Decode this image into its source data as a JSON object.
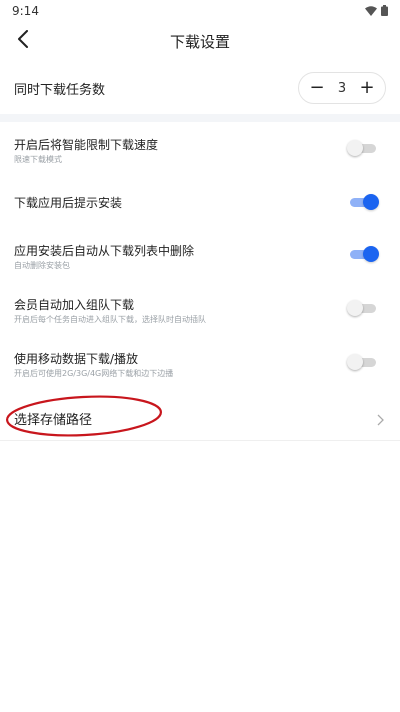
{
  "status_bar": {
    "time": "9:14"
  },
  "header": {
    "title": "下载设置"
  },
  "concurrent": {
    "label": "同时下载任务数",
    "minus": "−",
    "value": "3",
    "plus": "+"
  },
  "settings": [
    {
      "title": "开启后将智能限制下载速度",
      "subtitle": "限速下载模式",
      "enabled": false
    },
    {
      "title": "下载应用后提示安装",
      "subtitle": "",
      "enabled": true
    },
    {
      "title": "应用安装后自动从下载列表中删除",
      "subtitle": "自动删除安装包",
      "enabled": true
    },
    {
      "title": "会员自动加入组队下载",
      "subtitle": "开启后每个任务自动进入组队下载，选择队时自动插队",
      "enabled": false
    },
    {
      "title": "使用移动数据下载/播放",
      "subtitle": "开启后可使用2G/3G/4G网络下载和边下边播",
      "enabled": false
    }
  ],
  "storage": {
    "label": "选择存储路径"
  },
  "colors": {
    "accent": "#1b64f0",
    "annotation": "#c8161d",
    "divider": "#f3f5f8"
  }
}
